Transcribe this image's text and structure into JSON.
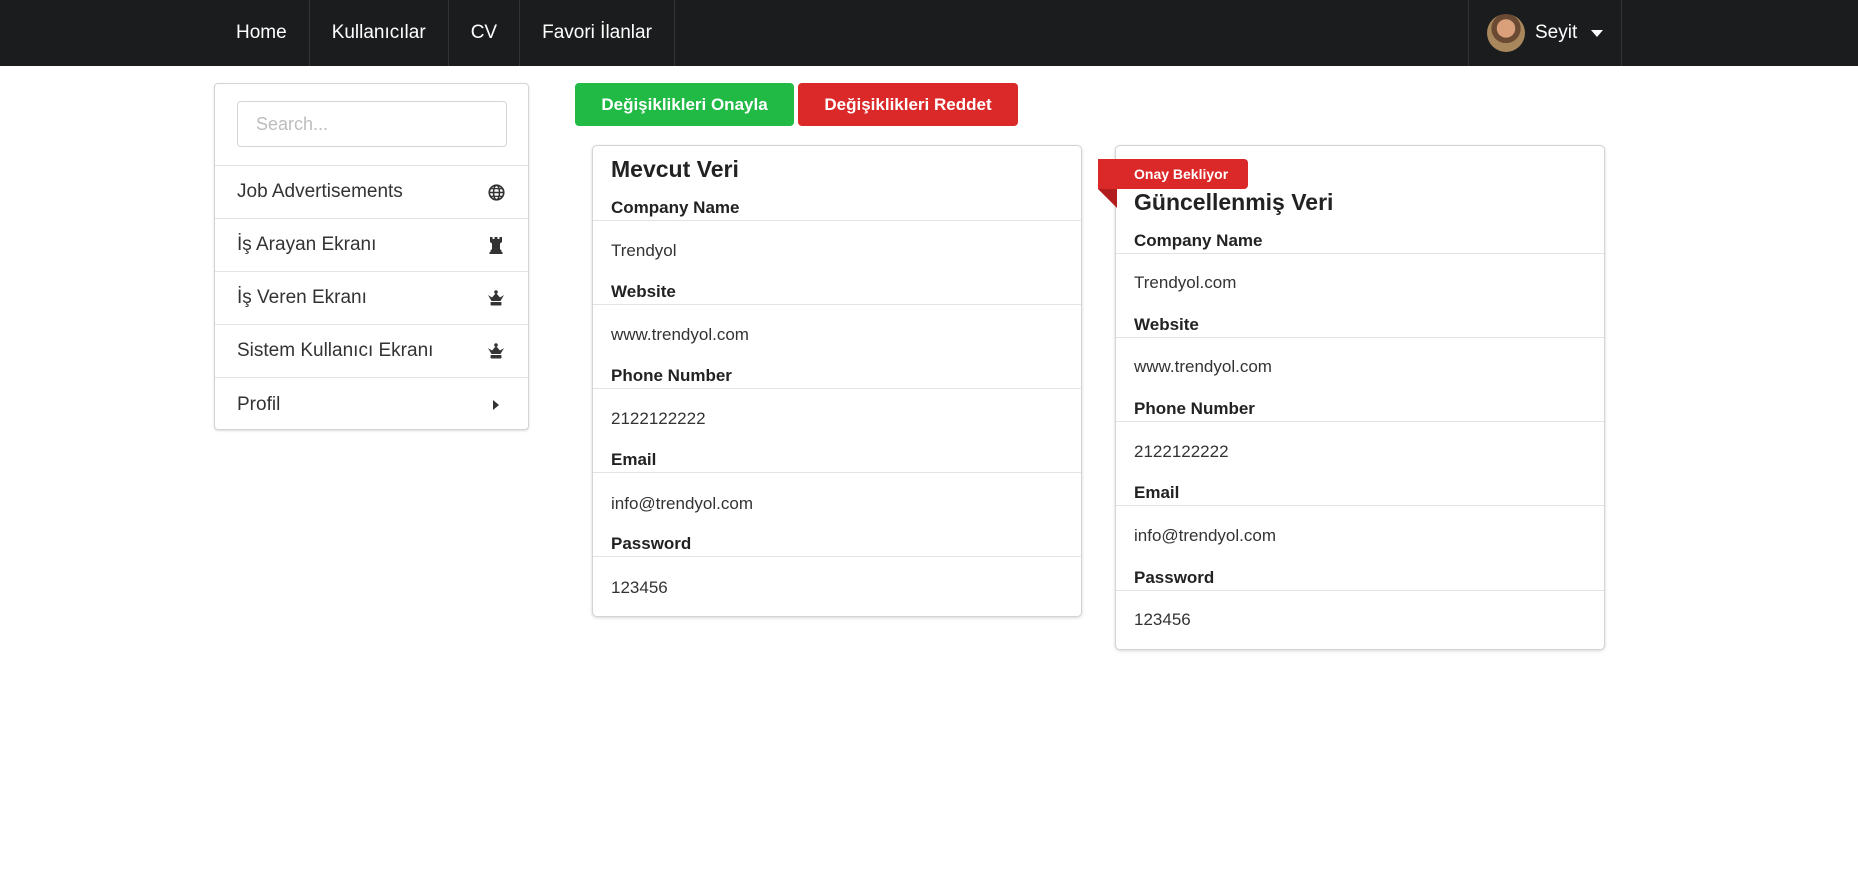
{
  "nav": {
    "items": [
      {
        "label": "Home"
      },
      {
        "label": "Kullanıcılar"
      },
      {
        "label": "CV"
      },
      {
        "label": "Favori İlanlar"
      }
    ],
    "user": {
      "name": "Seyit"
    }
  },
  "sidebar": {
    "search_placeholder": "Search...",
    "items": [
      {
        "label": "Job Advertisements",
        "icon": "globe-icon"
      },
      {
        "label": "İş Arayan Ekranı",
        "icon": "chess-rook-icon"
      },
      {
        "label": "İş Veren Ekranı",
        "icon": "chess-queen-icon"
      },
      {
        "label": "Sistem Kullanıcı Ekranı",
        "icon": "chess-queen-icon"
      },
      {
        "label": "Profil",
        "icon": "caret-right-icon"
      }
    ]
  },
  "actions": {
    "approve_label": "Değişiklikleri Onayla",
    "reject_label": "Değişiklikleri Reddet"
  },
  "colors": {
    "approve": "#21ba45",
    "reject": "#db2828",
    "navbar": "#1b1c1d"
  },
  "current": {
    "title": "Mevcut Veri",
    "fields": [
      {
        "label": "Company Name",
        "value": "Trendyol"
      },
      {
        "label": "Website",
        "value": "www.trendyol.com"
      },
      {
        "label": "Phone Number",
        "value": "2122122222"
      },
      {
        "label": "Email",
        "value": "info@trendyol.com"
      },
      {
        "label": "Password",
        "value": "123456"
      }
    ]
  },
  "updated": {
    "badge": "Onay Bekliyor",
    "title": "Güncellenmiş Veri",
    "fields": [
      {
        "label": "Company Name",
        "value": "Trendyol.com"
      },
      {
        "label": "Website",
        "value": "www.trendyol.com"
      },
      {
        "label": "Phone Number",
        "value": "2122122222"
      },
      {
        "label": "Email",
        "value": "info@trendyol.com"
      },
      {
        "label": "Password",
        "value": "123456"
      }
    ]
  }
}
